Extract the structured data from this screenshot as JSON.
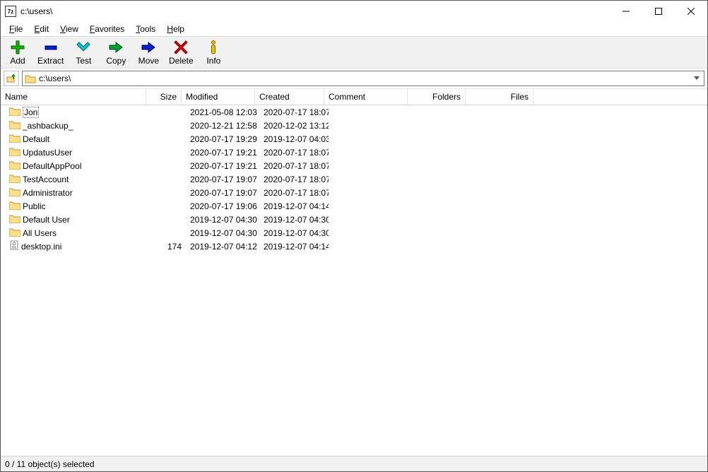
{
  "window": {
    "title": "c:\\users\\"
  },
  "menu": {
    "file": "File",
    "edit": "Edit",
    "view": "View",
    "favorites": "Favorites",
    "tools": "Tools",
    "help": "Help"
  },
  "toolbar": {
    "add": "Add",
    "extract": "Extract",
    "test": "Test",
    "copy": "Copy",
    "move": "Move",
    "delete": "Delete",
    "info": "Info"
  },
  "address": {
    "path": "c:\\users\\"
  },
  "columns": {
    "name": "Name",
    "size": "Size",
    "modified": "Modified",
    "created": "Created",
    "comment": "Comment",
    "folders": "Folders",
    "files": "Files"
  },
  "rows": [
    {
      "icon": "folder",
      "name": "Jon",
      "size": "",
      "modified": "2021-05-08 12:03",
      "created": "2020-07-17 18:07",
      "selected": true
    },
    {
      "icon": "folder",
      "name": "_ashbackup_",
      "size": "",
      "modified": "2020-12-21 12:58",
      "created": "2020-12-02 13:12"
    },
    {
      "icon": "folder",
      "name": "Default",
      "size": "",
      "modified": "2020-07-17 19:29",
      "created": "2019-12-07 04:03"
    },
    {
      "icon": "folder",
      "name": "UpdatusUser",
      "size": "",
      "modified": "2020-07-17 19:21",
      "created": "2020-07-17 18:07"
    },
    {
      "icon": "folder",
      "name": "DefaultAppPool",
      "size": "",
      "modified": "2020-07-17 19:21",
      "created": "2020-07-17 18:07"
    },
    {
      "icon": "folder",
      "name": "TestAccount",
      "size": "",
      "modified": "2020-07-17 19:07",
      "created": "2020-07-17 18:07"
    },
    {
      "icon": "folder",
      "name": "Administrator",
      "size": "",
      "modified": "2020-07-17 19:07",
      "created": "2020-07-17 18:07"
    },
    {
      "icon": "folder",
      "name": "Public",
      "size": "",
      "modified": "2020-07-17 19:06",
      "created": "2019-12-07 04:14"
    },
    {
      "icon": "folder",
      "name": "Default User",
      "size": "",
      "modified": "2019-12-07 04:30",
      "created": "2019-12-07 04:30"
    },
    {
      "icon": "folder",
      "name": "All Users",
      "size": "",
      "modified": "2019-12-07 04:30",
      "created": "2019-12-07 04:30"
    },
    {
      "icon": "file",
      "name": "desktop.ini",
      "size": "174",
      "modified": "2019-12-07 04:12",
      "created": "2019-12-07 04:14"
    }
  ],
  "status": {
    "text": "0 / 11 object(s) selected"
  }
}
